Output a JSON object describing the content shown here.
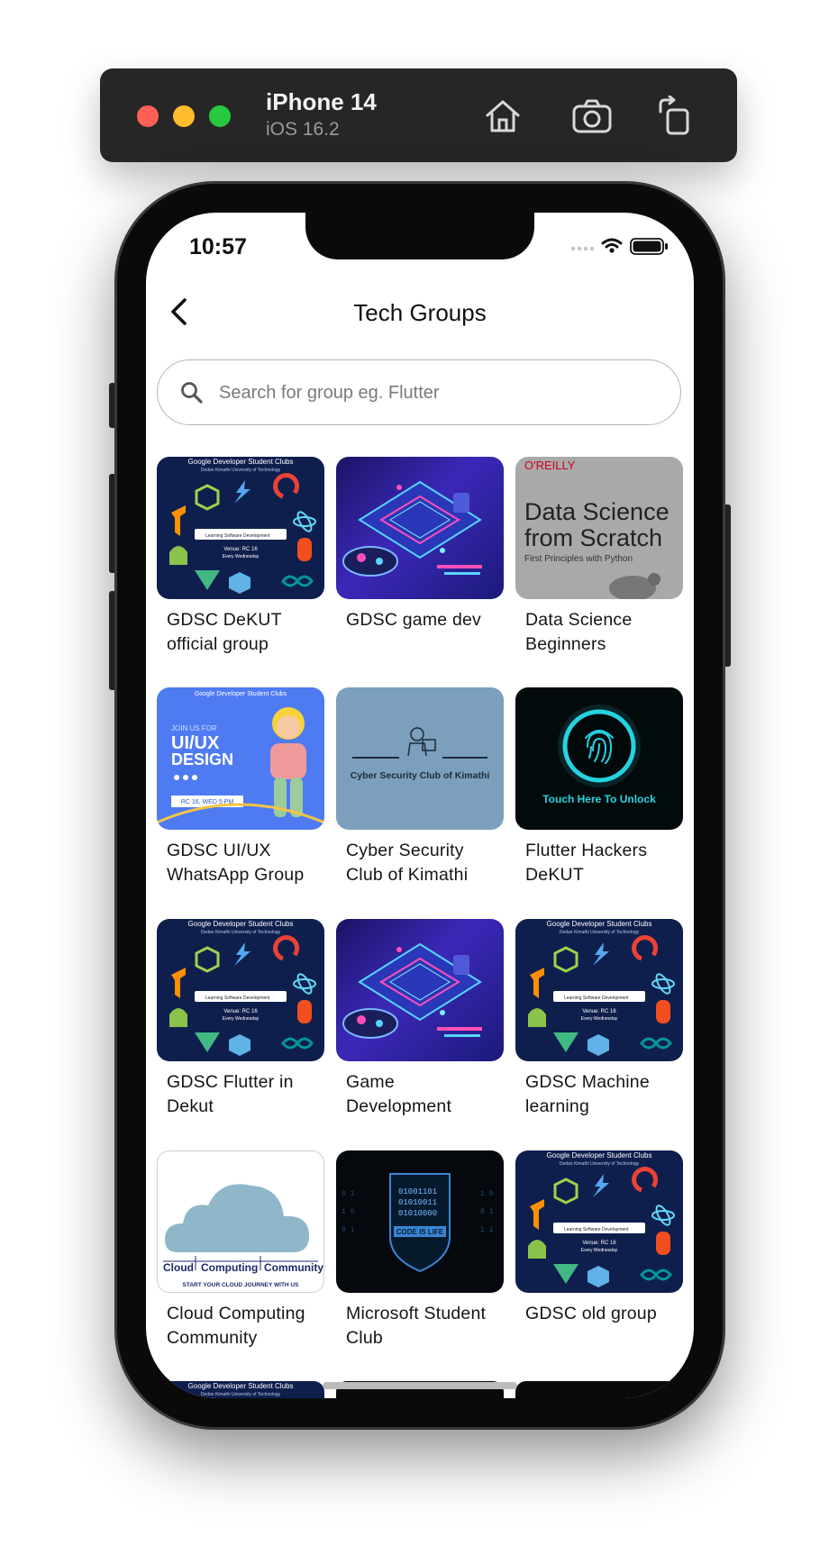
{
  "simulator": {
    "device": "iPhone 14",
    "os": "iOS 16.2"
  },
  "status_bar": {
    "time": "10:57"
  },
  "appbar": {
    "title": "Tech Groups"
  },
  "search": {
    "placeholder": "Search for group eg. Flutter",
    "value": ""
  },
  "groups": [
    {
      "name": "GDSC DeKUT official group",
      "thumbnail": "gdsc-banner"
    },
    {
      "name": "GDSC game dev",
      "thumbnail": "neon-gamepad"
    },
    {
      "name": "Data Science Beginners",
      "thumbnail": "book-cover",
      "cover_publisher": "O'REILLY",
      "cover_title": "Data Science from Scratch",
      "cover_subtitle": "First Principles with Python"
    },
    {
      "name": "GDSC UI/UX WhatsApp Group",
      "thumbnail": "uiux-poster",
      "poster_heading": "UI/UX DESIGN",
      "poster_kicker": "JOIN US FOR",
      "poster_pill": "RC 16, WED 5 PM"
    },
    {
      "name": "Cyber Security Club of Kimathi",
      "thumbnail": "cyber-logo",
      "logo_text": "Cyber Security Club of Kimathi"
    },
    {
      "name": "Flutter Hackers DeKUT",
      "thumbnail": "fingerprint",
      "caption": "Touch Here To Unlock"
    },
    {
      "name": "GDSC Flutter in Dekut",
      "thumbnail": "gdsc-banner"
    },
    {
      "name": "Game Development",
      "thumbnail": "neon-gamepad"
    },
    {
      "name": "GDSC Machine learning",
      "thumbnail": "gdsc-banner"
    },
    {
      "name": "Cloud Computing Community",
      "thumbnail": "cloud-logo",
      "logo_words": [
        "Cloud",
        "Computing",
        "Community"
      ],
      "tagline": "START YOUR CLOUD JOURNEY WITH US"
    },
    {
      "name": "Microsoft Student Club",
      "thumbnail": "code-shield",
      "shield_text": "CODE IS LIFE"
    },
    {
      "name": "GDSC old group",
      "thumbnail": "gdsc-banner"
    }
  ],
  "gdsc_banner": {
    "title": "Google Developer Student Clubs",
    "subtitle": "Dedan Kimathi University of Technology",
    "search_text": "Learning Software Development",
    "venue": "Venue: RC 16",
    "day": "Every Wednesday"
  },
  "colors": {
    "gdsc_bg": "#0f1f4d",
    "uiux_bg": "#4f7bf2",
    "cyber_bg": "#7b9fbd",
    "flutter_bg": "#030a0c",
    "flutter_glow": "#25d3e0",
    "cloud": "#8fb7c9",
    "cloud_text": "#1d2a6b"
  }
}
